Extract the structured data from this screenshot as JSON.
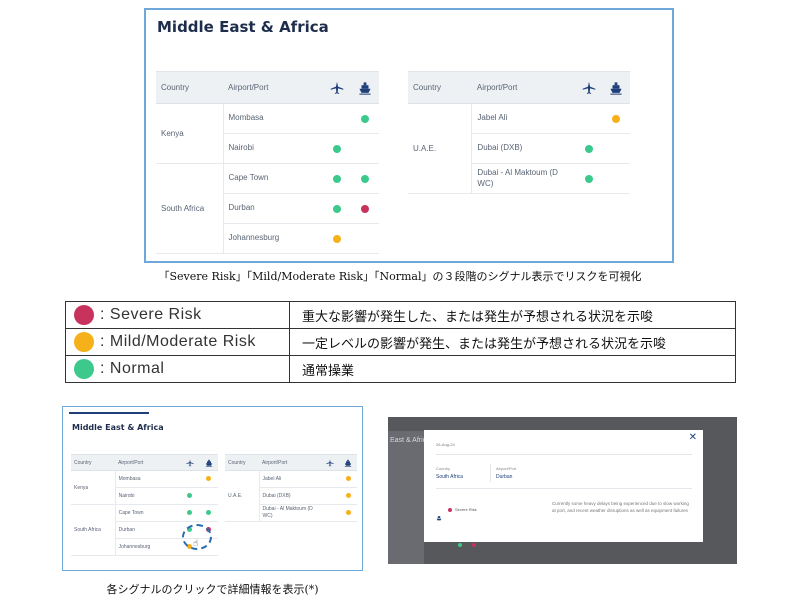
{
  "colors": {
    "severe": "#c8335e",
    "moderate": "#f6b01a",
    "normal": "#3dc98b",
    "navy": "#1f3f7a"
  },
  "panel_top": {
    "title": "Middle East & Africa",
    "headers": {
      "country": "Country",
      "airport": "Airport/Port"
    },
    "left_rows": [
      {
        "country": "Kenya",
        "rows": [
          {
            "airport": "Mombasa",
            "air": "",
            "sea": "normal"
          },
          {
            "airport": "Nairobi",
            "air": "normal",
            "sea": ""
          }
        ]
      },
      {
        "country": "South Africa",
        "rows": [
          {
            "airport": "Cape Town",
            "air": "normal",
            "sea": "normal"
          },
          {
            "airport": "Durban",
            "air": "normal",
            "sea": "severe"
          },
          {
            "airport": "Johannesburg",
            "air": "moderate",
            "sea": ""
          }
        ]
      }
    ],
    "right_rows": [
      {
        "country": "U.A.E.",
        "rows": [
          {
            "airport": "Jabel Ali",
            "air": "",
            "sea": "moderate"
          },
          {
            "airport": "Dubai (DXB)",
            "air": "normal",
            "sea": ""
          },
          {
            "airport": "Dubai - Al Maktoum (D WC)",
            "air": "normal",
            "sea": ""
          }
        ]
      }
    ]
  },
  "caption_top": "「Severe Risk」「Mild/Moderate Risk」「Normal」の３段階のシグナル表示でリスクを可視化",
  "legend": [
    {
      "key": "severe",
      "label": ": Severe Risk",
      "desc": "重大な影響が発生した、または発生が予想される状況を示唆"
    },
    {
      "key": "moderate",
      "label": ": Mild/Moderate Risk",
      "desc": "一定レベルの影響が発生、または発生が予想される状況を示唆"
    },
    {
      "key": "normal",
      "label": ": Normal",
      "desc": "通常操業"
    }
  ],
  "panel_small": {
    "title": "Middle East & Africa",
    "headers": {
      "country": "Country",
      "airport": "Airport/Port"
    },
    "left_rows": [
      {
        "country": "Kenya",
        "rows": [
          {
            "airport": "Mombasa",
            "air": "",
            "sea": "moderate"
          },
          {
            "airport": "Nairobi",
            "air": "normal",
            "sea": ""
          }
        ]
      },
      {
        "country": "South Africa",
        "rows": [
          {
            "airport": "Cape Town",
            "air": "normal",
            "sea": "normal"
          },
          {
            "airport": "Durban",
            "air": "normal",
            "sea": "severe"
          },
          {
            "airport": "Johannesburg",
            "air": "moderate",
            "sea": ""
          }
        ]
      }
    ],
    "right_rows": [
      {
        "country": "U.A.E.",
        "rows": [
          {
            "airport": "Jabel Ali",
            "air": "",
            "sea": "moderate"
          },
          {
            "airport": "Dubai (DXB)",
            "air": "",
            "sea": "moderate"
          },
          {
            "airport": "Dubai - Al Maktoum (D WC)",
            "air": "",
            "sea": "moderate"
          }
        ]
      }
    ]
  },
  "caption_bottom": "各シグナルのクリックで詳細情報を表示(*)",
  "modal": {
    "bg_title": "East & Afric",
    "date": "26-Aug-24",
    "country_label": "Country",
    "country_value": "South Africa",
    "airport_label": "Airport/Port",
    "airport_value": "Durban",
    "risk_label": "Severe Risk",
    "description": "Currently some heavy delays being experienced due to slow working at port, and recent weather disruptions as well as equipment failures"
  }
}
